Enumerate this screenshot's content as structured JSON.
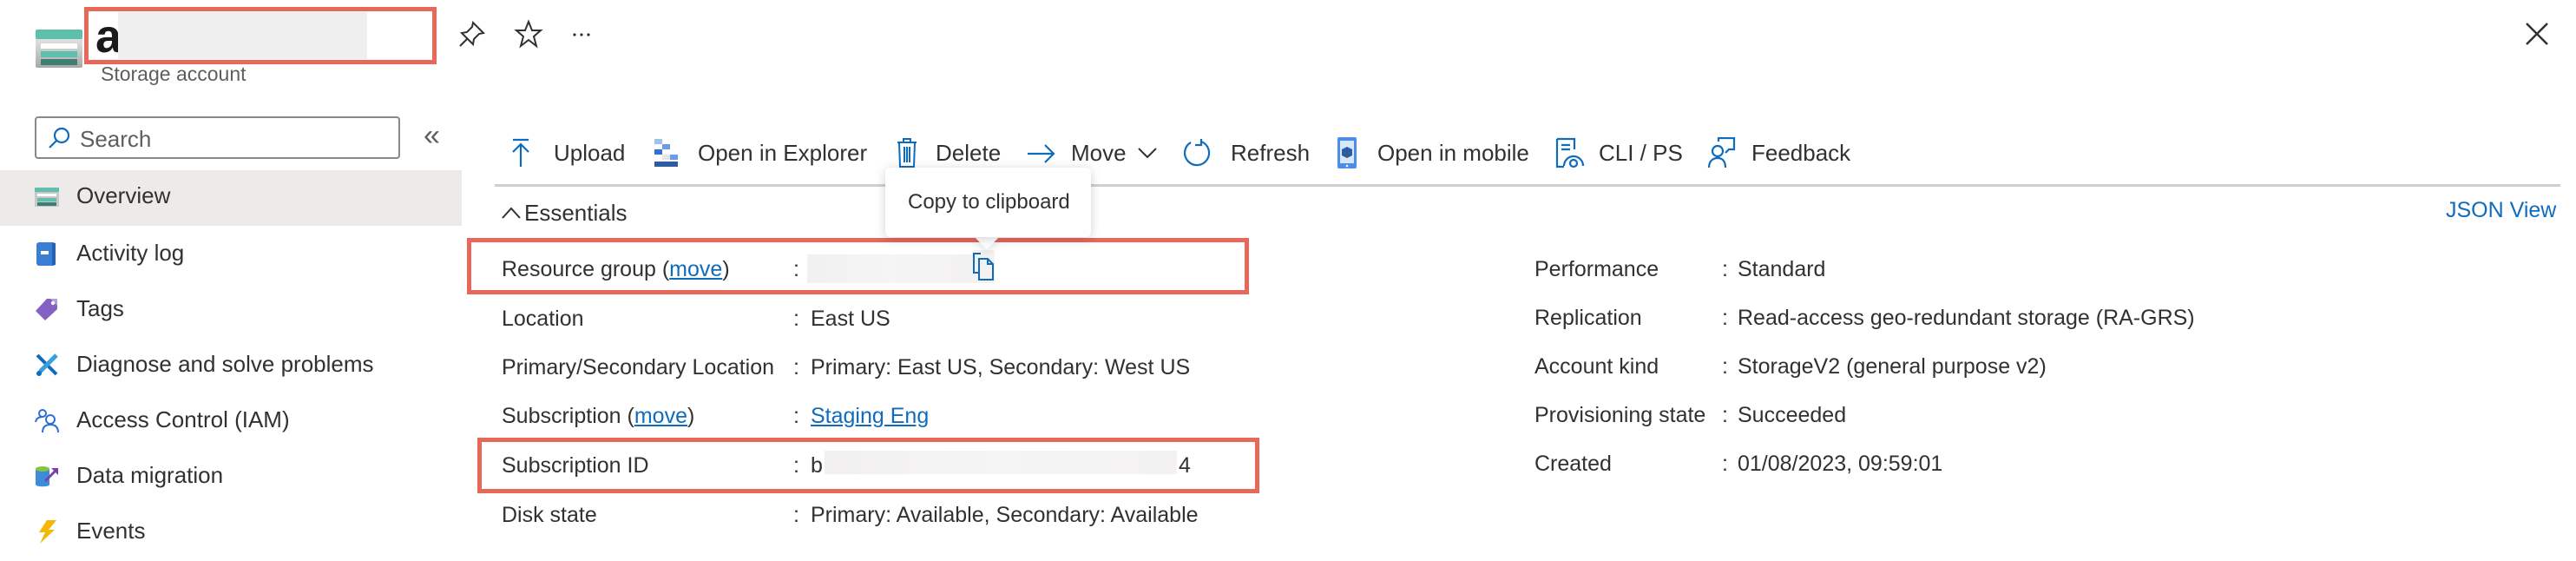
{
  "header": {
    "title": "ac              s",
    "subtitle": "Storage account",
    "icons": [
      "storage-account-icon",
      "pin-icon",
      "star-icon",
      "more-icon",
      "close-icon"
    ]
  },
  "sidebar": {
    "search_placeholder": "Search",
    "collapse_glyph": "«",
    "items": [
      {
        "label": "Overview",
        "icon": "overview-icon",
        "active": true
      },
      {
        "label": "Activity log",
        "icon": "activity-log-icon"
      },
      {
        "label": "Tags",
        "icon": "tag-icon"
      },
      {
        "label": "Diagnose and solve problems",
        "icon": "wrench-icon"
      },
      {
        "label": "Access Control (IAM)",
        "icon": "people-icon"
      },
      {
        "label": "Data migration",
        "icon": "data-migration-icon"
      },
      {
        "label": "Events",
        "icon": "lightning-icon"
      }
    ]
  },
  "toolbar": {
    "upload": "Upload",
    "open_explorer": "Open in Explorer",
    "delete": "Delete",
    "move": "Move",
    "refresh": "Refresh",
    "open_mobile": "Open in mobile",
    "cli_ps": "CLI / PS",
    "feedback": "Feedback"
  },
  "essentials": {
    "toggle_label": "Essentials",
    "json_view": "JSON View",
    "tooltip": "Copy to clipboard",
    "left": [
      {
        "label": "Resource group",
        "link": "move",
        "value": ""
      },
      {
        "label": "Location",
        "value": "East US"
      },
      {
        "label": "Primary/Secondary Location",
        "value": "Primary: East US, Secondary: West US"
      },
      {
        "label": "Subscription",
        "link": "move",
        "value": "Staging Eng"
      },
      {
        "label": "Subscription ID",
        "value_start": "b",
        "value_end": "4"
      },
      {
        "label": "Disk state",
        "value": "Primary: Available, Secondary: Available"
      }
    ],
    "right": [
      {
        "label": "Performance",
        "value": "Standard"
      },
      {
        "label": "Replication",
        "value": "Read-access geo-redundant storage (RA-GRS)"
      },
      {
        "label": "Account kind",
        "value": "StorageV2 (general purpose v2)"
      },
      {
        "label": "Provisioning state",
        "value": "Succeeded"
      },
      {
        "label": "Created",
        "value": "01/08/2023, 09:59:01"
      }
    ],
    "colon": ":"
  },
  "colors": {
    "accent": "#0f6cbd",
    "highlight_box": "#e8665a",
    "active_nav": "#edebe9"
  }
}
